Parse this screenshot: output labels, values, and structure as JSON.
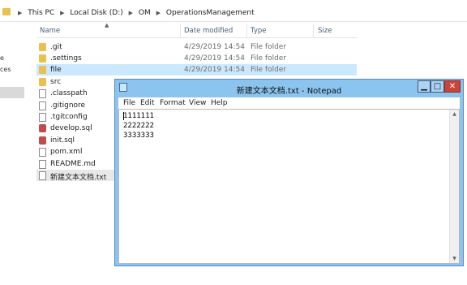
{
  "explorer": {
    "breadcrumb": [
      "This PC",
      "Local Disk (D:)",
      "OM",
      "OperationsManagement"
    ],
    "columns": [
      "Name",
      "Date modified",
      "Type",
      "Size"
    ],
    "nav_fragments": [
      "e",
      "ces"
    ],
    "files": [
      {
        "name": ".git",
        "date": "4/29/2019 14:54",
        "type": "File folder",
        "icon": "folder-icon"
      },
      {
        "name": ".settings",
        "date": "4/29/2019 14:54",
        "type": "File folder",
        "icon": "folder-icon"
      },
      {
        "name": "file",
        "date": "4/29/2019 14:54",
        "type": "File folder",
        "icon": "folder-icon"
      },
      {
        "name": "src",
        "date": "",
        "type": "",
        "icon": "folder-icon"
      },
      {
        "name": ".classpath",
        "date": "",
        "type": "",
        "icon": "file-icon"
      },
      {
        "name": ".gitignore",
        "date": "",
        "type": "",
        "icon": "file-icon"
      },
      {
        "name": ".tgitconfig",
        "date": "",
        "type": "",
        "icon": "file-icon"
      },
      {
        "name": "develop.sql",
        "date": "",
        "type": "",
        "icon": "sql-file-icon"
      },
      {
        "name": "init.sql",
        "date": "",
        "type": "",
        "icon": "sql-file-icon"
      },
      {
        "name": "pom.xml",
        "date": "",
        "type": "",
        "icon": "xml-file-icon"
      },
      {
        "name": "README.md",
        "date": "",
        "type": "",
        "icon": "file-icon"
      },
      {
        "name": "新建文本文档.txt",
        "date": "",
        "type": "",
        "icon": "text-file-icon"
      }
    ]
  },
  "notepad": {
    "title": "新建文本文档.txt - Notepad",
    "menu": [
      "File",
      "Edit",
      "Format",
      "View",
      "Help"
    ],
    "content": "1111111\n2222222\n3333333",
    "buttons": {
      "minimize": "▁",
      "maximize": "□",
      "close": "✕"
    }
  },
  "colors": {
    "selection": "#cce8ff",
    "title_bar": "#8ac4ef",
    "close_button": "#c9453a",
    "folder": "#e8c14f"
  }
}
